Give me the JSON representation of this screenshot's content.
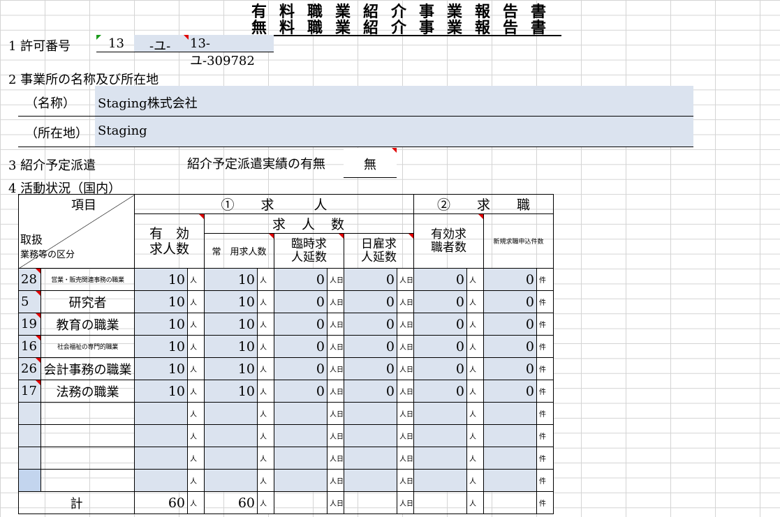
{
  "title_lines": [
    "有料職業紹介事業報告書",
    "無料職業紹介事業報告書"
  ],
  "section1": {
    "label": "1 許可番号",
    "num1": "13",
    "mid": "-ユ-",
    "full": "13-ユ-309782"
  },
  "section2": {
    "label": "2 事業所の名称及び所在地",
    "name_label": "（名称）",
    "name_value": "Staging株式会社",
    "addr_label": "（所在地）",
    "addr_value": "Staging"
  },
  "section3": {
    "label": "3 紹介予定派遣",
    "question": "紹介予定派遣実績の有無",
    "answer": "無"
  },
  "section4": {
    "label": "4 活動状況（国内）"
  },
  "table": {
    "h_item": "項目",
    "h_handling1": "取扱",
    "h_handling2": "業務等の区分",
    "h_kyujin": "①　　求　　　人",
    "h_kyushoku": "②　　求　　職",
    "h_kyujinsu": "求　人　数",
    "h_yuko1": "有　効",
    "h_yuko2": "求人数",
    "h_jouyou": "常　用求人数",
    "h_rinji1": "臨時求",
    "h_rinji2": "人延数",
    "h_hiyatoi1": "日雇求",
    "h_hiyatoi2": "人延数",
    "h_yukokyushoku1": "有効求",
    "h_yukokyushoku2": "職者数",
    "h_shinki": "新規求職申込件数",
    "unit_person": "人",
    "unit_day": "人日",
    "unit_case": "件",
    "rows": [
      {
        "code": "28",
        "name": "営業・販売関連事務の職業",
        "small": true,
        "v": [
          "10",
          "10",
          "0",
          "0",
          "0",
          "0"
        ]
      },
      {
        "code": "5",
        "name": "研究者",
        "small": false,
        "v": [
          "10",
          "10",
          "0",
          "0",
          "0",
          "0"
        ]
      },
      {
        "code": "19",
        "name": "教育の職業",
        "small": false,
        "v": [
          "10",
          "10",
          "0",
          "0",
          "0",
          "0"
        ]
      },
      {
        "code": "16",
        "name": "社会福祉の専門的職業",
        "small": true,
        "v": [
          "10",
          "10",
          "0",
          "0",
          "0",
          "0"
        ]
      },
      {
        "code": "26",
        "name": "会計事務の職業",
        "small": false,
        "v": [
          "10",
          "10",
          "0",
          "0",
          "0",
          "0"
        ]
      },
      {
        "code": "17",
        "name": "法務の職業",
        "small": false,
        "v": [
          "10",
          "10",
          "0",
          "0",
          "0",
          "0"
        ]
      },
      {
        "code": "",
        "name": "",
        "small": false,
        "v": [
          "",
          "",
          "",
          "",
          "",
          ""
        ]
      },
      {
        "code": "",
        "name": "",
        "small": false,
        "v": [
          "",
          "",
          "",
          "",
          "",
          ""
        ]
      },
      {
        "code": "",
        "name": "",
        "small": false,
        "v": [
          "",
          "",
          "",
          "",
          "",
          ""
        ]
      },
      {
        "code": "",
        "name": "",
        "small": false,
        "v": [
          "",
          "",
          "",
          "",
          "",
          ""
        ]
      }
    ],
    "total_label": "計",
    "total": [
      "60",
      "60",
      "",
      "",
      "",
      ""
    ]
  }
}
